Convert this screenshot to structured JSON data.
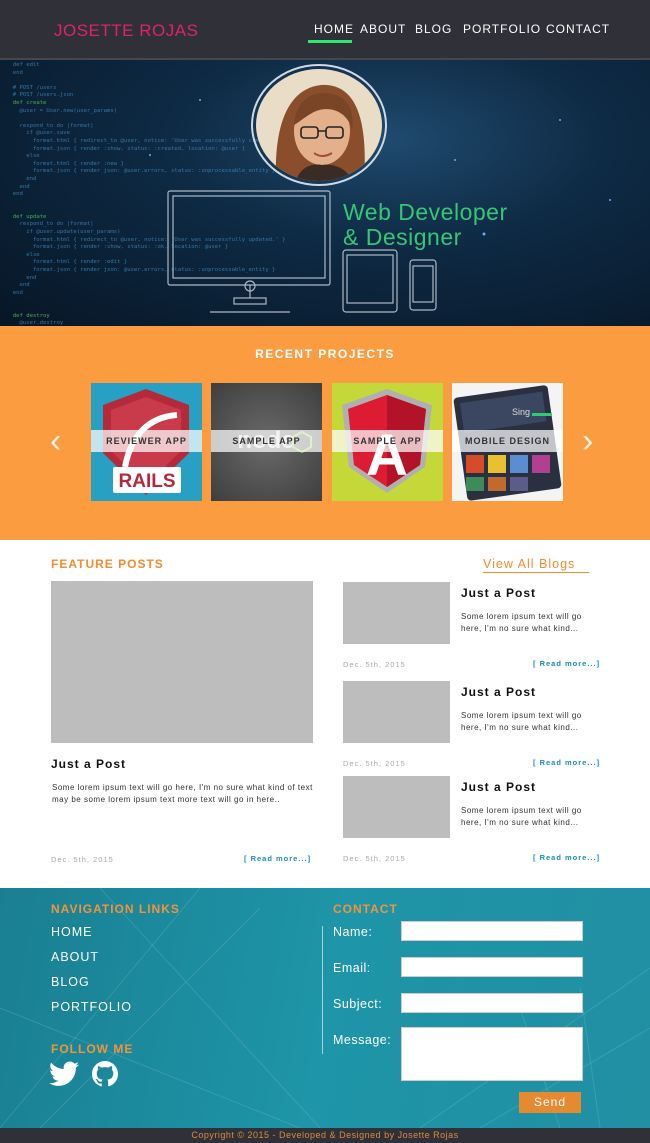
{
  "brand": "JOSETTE ROJAS",
  "nav": {
    "items": [
      "HOME",
      "ABOUT",
      "BLOG",
      "PORTFOLIO",
      "CONTACT"
    ],
    "active": "HOME"
  },
  "hero": {
    "title_line1": "Web Developer",
    "title_line2": "& Designer"
  },
  "projects": {
    "title": "RECENT PROJECTS",
    "items": [
      {
        "label": "REVIEWER APP",
        "logo_text": "RAILS"
      },
      {
        "label": "SAMPLE APP",
        "logo_text": "node"
      },
      {
        "label": "SAMPLE APP",
        "logo_text": "A"
      },
      {
        "label": "MOBILE DESIGN",
        "logo_text": "Sing"
      }
    ]
  },
  "feature": {
    "title": "FEATURE POSTS",
    "view_all": "View All Blogs",
    "main_post": {
      "title": "Just a Post",
      "text": "Some lorem ipsum text will go here, I'm no sure what kind of text may be some lorem ipsum text more text will go in here..",
      "date": "Dec. 5th, 2015",
      "read_more": "[ Read more...]"
    },
    "side_posts": [
      {
        "title": "Just a Post",
        "text": "Some lorem ipsum text will go here, I'm no sure what kind...",
        "date": "Dec. 5th, 2015",
        "read_more": "[ Read more...]"
      },
      {
        "title": "Just a Post",
        "text": "Some lorem ipsum text will go here, I'm no sure what kind...",
        "date": "Dec. 5th, 2015",
        "read_more": "[ Read more...]"
      },
      {
        "title": "Just a Post",
        "text": "Some lorem ipsum text will go here, I'm no sure what kind...",
        "date": "Dec. 5th, 2015",
        "read_more": "[ Read more...]"
      }
    ]
  },
  "footer": {
    "nav_title": "NAVIGATION LINKS",
    "nav_links": [
      "HOME",
      "ABOUT",
      "BLOG",
      "PORTFOLIO"
    ],
    "follow_title": "FOLLOW ME",
    "social_icons": [
      "twitter-icon",
      "github-icon"
    ],
    "contact_title": "CONTACT",
    "fields": [
      "Name:",
      "Email:",
      "Subject:",
      "Message:"
    ],
    "send": "Send",
    "copyright": "Copyright © 2015 - Developed & Designed by Josette Rojas"
  },
  "colors": {
    "nav_bg": "#2f3038",
    "brand": "#e0226e",
    "active_underline": "#2ee86e",
    "hero_text": "#33c776",
    "projects_bg": "#fb9c41",
    "accent_orange": "#f08c30",
    "link_blue": "#1a8fb0",
    "footer_teal": "#1e95a8"
  }
}
